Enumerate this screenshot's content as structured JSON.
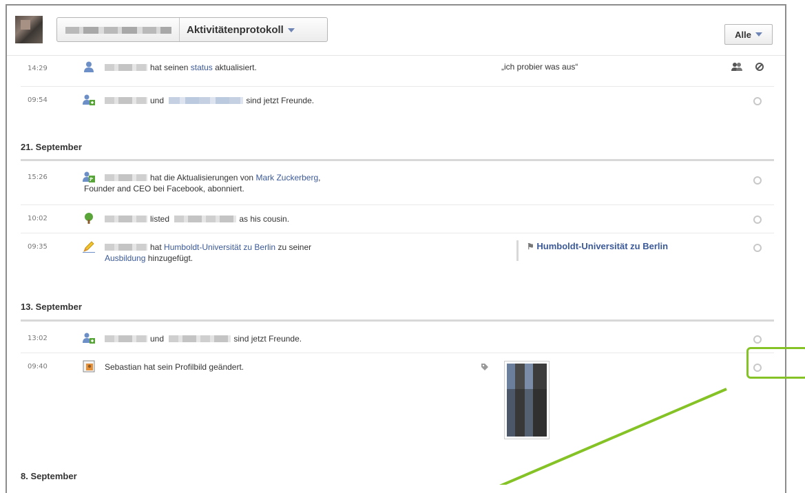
{
  "header": {
    "title": "Aktivitätenprotokoll",
    "filter_label": "Alle"
  },
  "rows": [
    {
      "time": "14:29",
      "icon": "user-icon",
      "text_a": "hat seinen",
      "link_a": "status",
      "text_b": "aktualisiert.",
      "quote": "„ich probier was aus“"
    },
    {
      "time": "09:54",
      "icon": "friends-icon",
      "text_a": "und",
      "text_b": "sind jetzt Freunde."
    }
  ],
  "sections": [
    {
      "title": "21. September",
      "rows": [
        {
          "time": "15:26",
          "icon": "subscribe-icon",
          "text_a": "hat die Aktualisierungen von",
          "link_a": "Mark Zuckerberg",
          "text_b": ",",
          "line2": "Founder and CEO bei Facebook, abonniert."
        },
        {
          "time": "10:02",
          "icon": "tree-icon",
          "text_a": "listed",
          "text_b": "as his cousin."
        },
        {
          "time": "09:35",
          "icon": "pencil-icon",
          "text_a": "hat",
          "link_a": "Humboldt-Universität zu Berlin",
          "text_b": "zu seiner",
          "link_b": "Ausbildung",
          "line2": "hinzugefügt.",
          "uni": "Humboldt-Universität zu Berlin"
        }
      ]
    },
    {
      "title": "13. September",
      "rows": [
        {
          "time": "13:02",
          "icon": "friends-icon",
          "text_a": "und",
          "text_b": "sind jetzt Freunde."
        },
        {
          "time": "09:40",
          "icon": "photo-icon",
          "text_a": "Sebastian hat sein Profilbild geändert."
        }
      ]
    },
    {
      "title": "8. September",
      "rows": []
    }
  ],
  "colors": {
    "link": "#3b5998",
    "highlight": "#84c226"
  }
}
